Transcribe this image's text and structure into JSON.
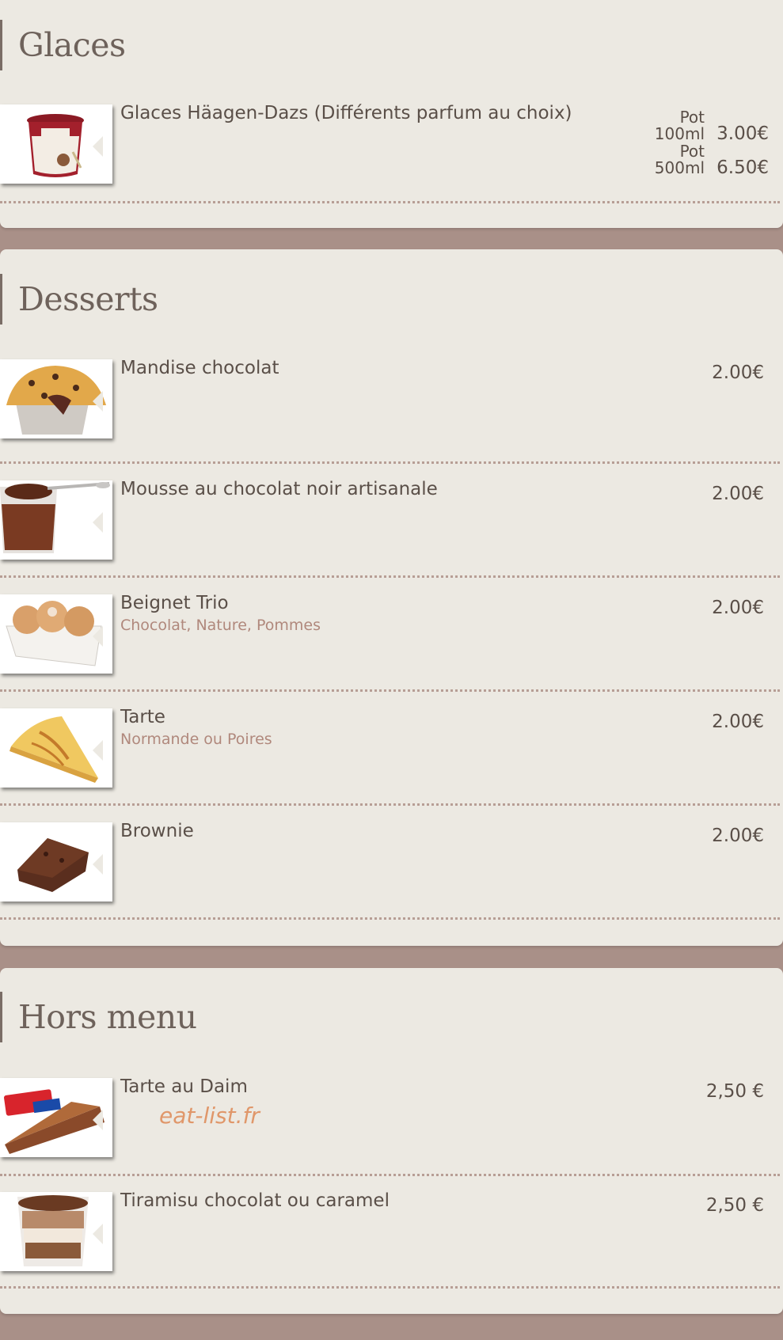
{
  "colors": {
    "page_background": "#a99088",
    "panel_background": "#ece9e2",
    "text": "#5a4f48",
    "description": "#b0887c",
    "dotted_separator": "#b79e95",
    "watermark": "#e0976a"
  },
  "sections": [
    {
      "title": "Glaces",
      "items": [
        {
          "name": "Glaces Häagen-Dazs (Différents parfum au choix)",
          "image": "haagen-dazs-pot-image",
          "sizes": [
            {
              "label_line1": "Pot",
              "label_line2": "100ml",
              "price": "3.00€"
            },
            {
              "label_line1": "Pot",
              "label_line2": "500ml",
              "price": "6.50€"
            }
          ]
        }
      ]
    },
    {
      "title": "Desserts",
      "items": [
        {
          "name": "Mandise chocolat",
          "description": "",
          "price": "2.00€",
          "image": "muffin-image"
        },
        {
          "name": "Mousse au chocolat noir artisanale",
          "description": "",
          "price": "2.00€",
          "image": "chocolate-mousse-image"
        },
        {
          "name": "Beignet Trio",
          "description": "Chocolat, Nature, Pommes",
          "price": "2.00€",
          "image": "beignets-image"
        },
        {
          "name": "Tarte",
          "description": "Normande ou Poires",
          "price": "2.00€",
          "image": "tart-slice-image"
        },
        {
          "name": "Brownie",
          "description": "",
          "price": "2.00€",
          "image": "brownie-image"
        }
      ]
    },
    {
      "title": "Hors menu",
      "items": [
        {
          "name": "Tarte au Daim",
          "description": "",
          "price": "2,50 €",
          "image": "daim-tart-image"
        },
        {
          "name": "Tiramisu chocolat ou caramel",
          "description": "",
          "price": "2,50 €",
          "image": "tiramisu-glass-image"
        }
      ]
    }
  ],
  "watermark": "eat-list.fr"
}
